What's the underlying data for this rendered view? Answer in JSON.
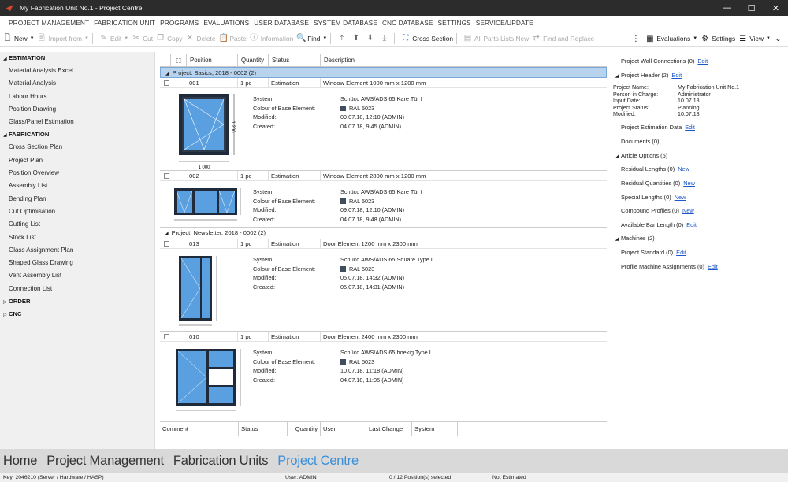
{
  "window": {
    "title": "My Fabrication Unit No.1 - Project Centre",
    "min": "—",
    "max": "☐",
    "close": "✕"
  },
  "menu": [
    "PROJECT MANAGEMENT",
    "FABRICATION UNIT",
    "PROGRAMS",
    "EVALUATIONS",
    "USER DATABASE",
    "SYSTEM DATABASE",
    "CNC DATABASE",
    "SETTINGS",
    "SERVICE/UPDATE"
  ],
  "toolbar": {
    "new": "New",
    "import_from": "Import from",
    "edit": "Edit",
    "cut": "Cut",
    "copy": "Copy",
    "delete": "Delete",
    "paste": "Paste",
    "information": "Information",
    "find": "Find",
    "cross_section": "Cross Section",
    "all_parts_lists_new": "All Parts Lists New",
    "find_and_replace": "Find and Replace",
    "evaluations": "Evaluations",
    "settings": "Settings",
    "view": "View"
  },
  "sidebar": {
    "estimation": {
      "label": "ESTIMATION",
      "items": [
        "Material Analysis Excel",
        "Material Analysis",
        "Labour Hours",
        "Position Drawing",
        "Glass/Panel Estimation"
      ]
    },
    "fabrication": {
      "label": "FABRICATION",
      "items": [
        "Cross Section Plan",
        "Project Plan",
        "Position Overview",
        "Assembly List",
        "Bending Plan",
        "Cut Optimisation",
        "Cutting List",
        "Stock List",
        "Glass Assignment Plan",
        "Shaped Glass Drawing",
        "Vent Assembly List",
        "Connection List"
      ]
    },
    "order": {
      "label": "ORDER"
    },
    "cnc": {
      "label": "CNC"
    }
  },
  "grid": {
    "headers": {
      "position": "Position",
      "quantity": "Quantity",
      "status": "Status",
      "description": "Description"
    },
    "groups": [
      {
        "label": "Project: Basics, 2018 - 0002 (2)"
      },
      {
        "label": "Project: Newsletter, 2018 - 0002 (2)"
      }
    ],
    "detail_labels": {
      "system": "System:",
      "colour": "Colour of Base Element:",
      "modified": "Modified:",
      "created": "Created:"
    },
    "entries": [
      {
        "position": "001",
        "quantity": "1 pc",
        "status": "Estimation",
        "description": "Window Element 1000 mm x 1200 mm",
        "system": "Schüco AWS/ADS 65 Kare Tür I",
        "colour": "RAL 5023",
        "modified": "09.07.18, 12:10 (ADMIN)",
        "created": "04.07.18,  9:45 (ADMIN)",
        "dim_w": "1 000",
        "dim_h": "1 200"
      },
      {
        "position": "002",
        "quantity": "1 pc",
        "status": "Estimation",
        "description": "Window Element 2800 mm x 1200 mm",
        "system": "Schüco AWS/ADS 65 Kare Tür I",
        "colour": "RAL 5023",
        "modified": "09.07.18, 12:10 (ADMIN)",
        "created": "04.07.18,  9:48 (ADMIN)"
      },
      {
        "position": "013",
        "quantity": "1 pc",
        "status": "Estimation",
        "description": "Door Element 1200 mm x 2300 mm",
        "system": "Schüco AWS/ADS 65 Square Type I",
        "colour": "RAL 5023",
        "modified": "05.07.18, 14:32 (ADMIN)",
        "created": "05.07.18, 14:31 (ADMIN)"
      },
      {
        "position": "010",
        "quantity": "1 pc",
        "status": "Estimation",
        "description": "Door Element 2400 mm x 2300 mm",
        "system": "Schüco AWS/ADS 65 hoekig Type I",
        "colour": "RAL 5023",
        "modified": "10.07.18, 11:18 (ADMIN)",
        "created": "04.07.18, 11:05 (ADMIN)"
      }
    ],
    "bottom_headers": {
      "comment": "Comment",
      "status": "Status",
      "quantity": "Quantity",
      "user": "User",
      "last_change": "Last Change",
      "system": "System"
    }
  },
  "right_panel": {
    "wall_connections": "Project Wall Connections (0)",
    "project_header": "Project Header (2)",
    "edit": "Edit",
    "new": "New",
    "header_fields": [
      {
        "k": "Project Name:",
        "v": "My Fabrication Unit No.1"
      },
      {
        "k": "Person in Charge:",
        "v": "Administrator"
      },
      {
        "k": "Input Date:",
        "v": "10.07.18"
      },
      {
        "k": "Project Status:",
        "v": "Planning"
      },
      {
        "k": "Modified:",
        "v": "10.07.18"
      }
    ],
    "estimation_data": "Project Estimation Data",
    "documents": "Documents (0)",
    "article_options": "Article Options (5)",
    "residual_lengths": "Residual Lengths (0)",
    "residual_quantities": "Residual Quantities (0)",
    "special_lengths": "Special Lengths (0)",
    "compound_profiles": "Compound Profiles (0)",
    "available_bar_length": "Available Bar Length (0)",
    "machines": "Machines (2)",
    "project_standard": "Project Standard (0)",
    "profile_machine_assignments": "Profile Machine Assignments (0)"
  },
  "nav": {
    "home": "Home",
    "project_management": "Project Management",
    "fabrication_units": "Fabrication Units",
    "project_centre": "Project Centre"
  },
  "status": {
    "key": "Key: 2046210 (Server / Hardware / HASP)",
    "user": "User: ADMIN",
    "selected": "0 / 12 Position(s) selected",
    "estimated": "Not Estimated"
  },
  "colors": {
    "accent": "#3a8fd8",
    "frame": "#1f2b3a",
    "glass": "#5aa0e0",
    "selection": "#b7d3ee"
  }
}
